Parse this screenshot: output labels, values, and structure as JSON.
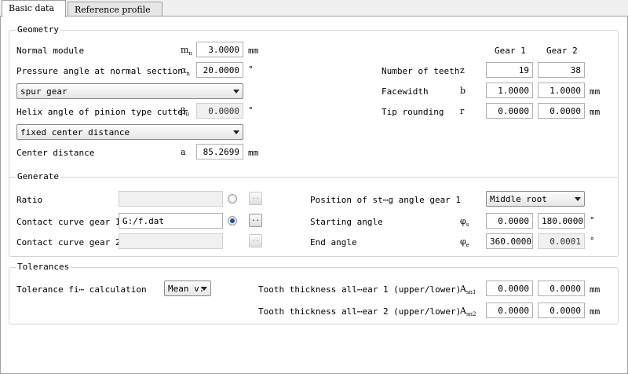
{
  "tabs": [
    {
      "label": "Basic data",
      "active": true
    },
    {
      "label": "Reference profile",
      "active": false
    }
  ],
  "geometry": {
    "title": "Geometry",
    "normal_module": {
      "label": "Normal module",
      "symbol": "m",
      "sub": "n",
      "value": "3.0000",
      "unit": "mm"
    },
    "pressure_angle": {
      "label": "Pressure angle at normal section",
      "symbol": "α",
      "sub": "n",
      "value": "20.0000",
      "unit": "°"
    },
    "gear_type": "spur gear",
    "helix_angle": {
      "label": "Helix angle of pinion type cutter",
      "symbol": "β",
      "sub": "0",
      "value": "0.0000",
      "unit": "°"
    },
    "center_mode": "fixed center distance",
    "center_distance": {
      "label": "Center distance",
      "symbol": "a",
      "value": "85.2699",
      "unit": "mm"
    },
    "gear1_header": "Gear 1",
    "gear2_header": "Gear 2",
    "teeth": {
      "label": "Number of teeth",
      "symbol": "z",
      "g1": "19",
      "g2": "38"
    },
    "facewidth": {
      "label": "Facewidth",
      "symbol": "b",
      "g1": "1.0000",
      "g2": "1.0000",
      "unit": "mm"
    },
    "tip_rounding": {
      "label": "Tip rounding",
      "symbol": "r",
      "g1": "0.0000",
      "g2": "0.0000",
      "unit": "mm"
    }
  },
  "generate": {
    "title": "Generate",
    "ratio_label": "Ratio",
    "ratio_value": "",
    "curve1_label": "Contact curve gear 1",
    "curve1_value": "G:/f.dat",
    "curve2_label": "Contact curve gear 2",
    "curve2_value": "",
    "browse_label": "..",
    "position_label": "Position of st⋯g angle gear 1",
    "position_value": "Middle root",
    "starting": {
      "label": "Starting angle",
      "symbol": "φ",
      "sub": "s",
      "v1": "0.0000",
      "v2": "180.0000",
      "unit": "°"
    },
    "end": {
      "label": "End angle",
      "symbol": "φ",
      "sub": "e",
      "v1": "360.0000",
      "v2": "0.0001",
      "unit": "°"
    }
  },
  "tolerances": {
    "title": "Tolerances",
    "calc_label": "Tolerance fi⋯ calculation",
    "calc_value": "Mean v:",
    "tooth1": {
      "label": "Tooth thickness all⋯ear 1 (upper/lower)",
      "symbol": "A",
      "sub": "sn1",
      "v1": "0.0000",
      "v2": "0.0000",
      "unit": "mm"
    },
    "tooth2": {
      "label": "Tooth thickness all⋯ear 2 (upper/lower)",
      "symbol": "A",
      "sub": "sn2",
      "v1": "0.0000",
      "v2": "0.0000",
      "unit": "mm"
    }
  }
}
